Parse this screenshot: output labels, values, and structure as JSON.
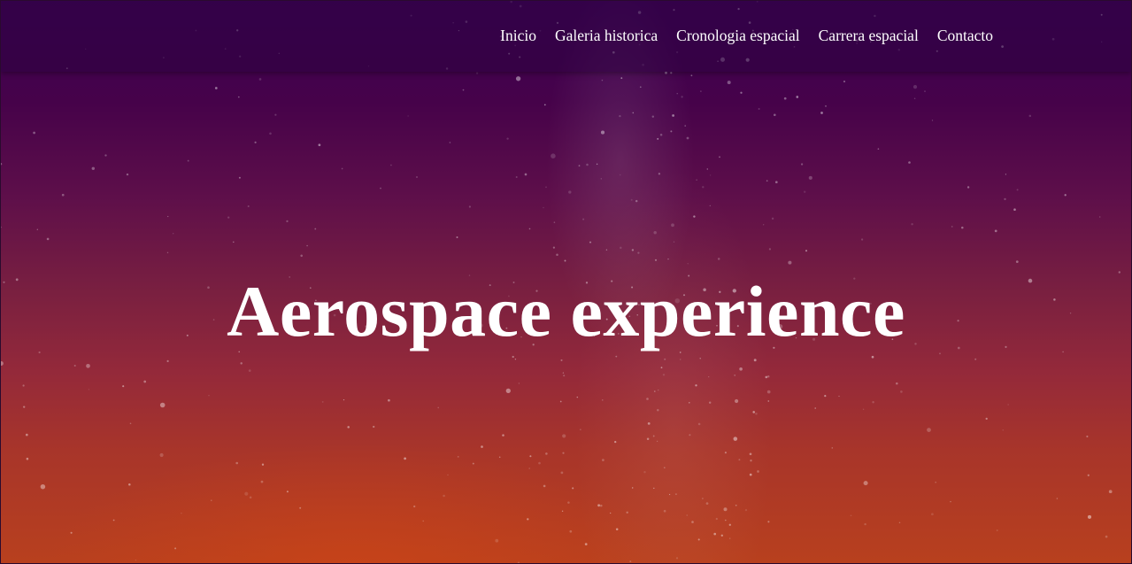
{
  "nav": {
    "items": [
      {
        "label": "Inicio"
      },
      {
        "label": "Galeria historica"
      },
      {
        "label": "Cronologia espacial"
      },
      {
        "label": "Carrera espacial"
      },
      {
        "label": "Contacto"
      }
    ]
  },
  "hero": {
    "title": "Aerospace experience"
  }
}
